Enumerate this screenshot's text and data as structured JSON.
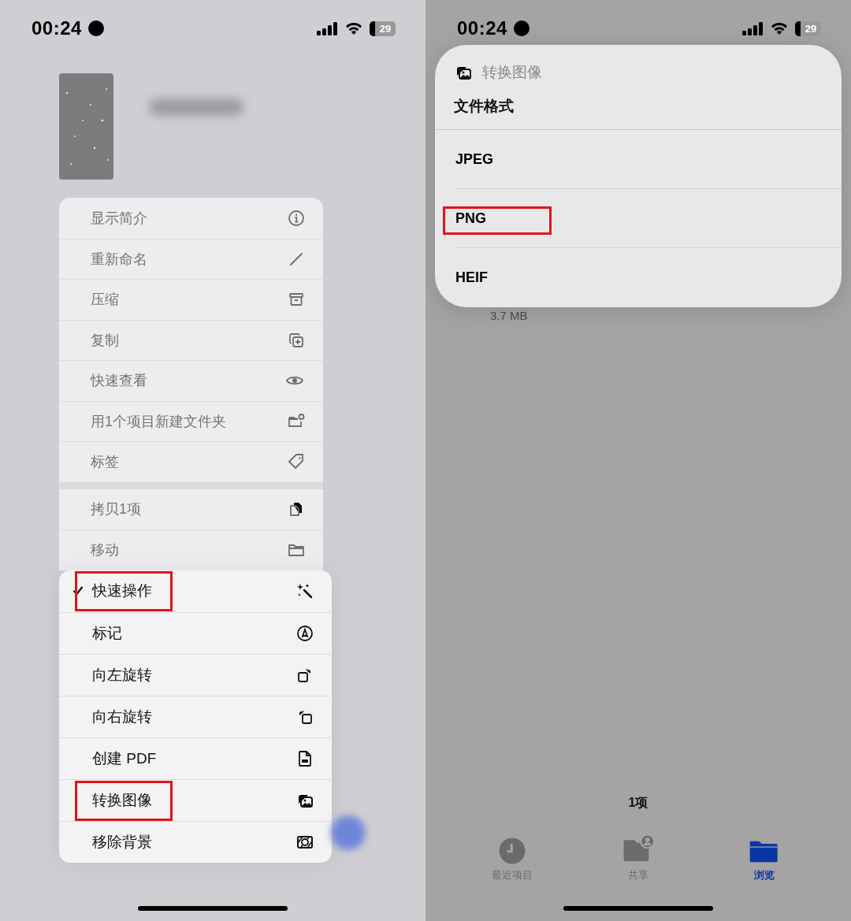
{
  "left_screen": {
    "status_bar": {
      "time": "00:24",
      "battery": "29"
    },
    "context_menu": {
      "groups": [
        [
          {
            "label": "显示简介"
          },
          {
            "label": "重新命名"
          },
          {
            "label": "压缩"
          },
          {
            "label": "复制"
          },
          {
            "label": "快速查看"
          },
          {
            "label": "用1个项目新建文件夹"
          },
          {
            "label": "标签"
          }
        ],
        [
          {
            "label": "拷贝1项"
          },
          {
            "label": "移动"
          }
        ]
      ]
    },
    "quick_actions_menu": {
      "items": [
        {
          "label": "快速操作",
          "checked": true,
          "highlighted": true
        },
        {
          "label": "标记",
          "checked": false,
          "highlighted": false
        },
        {
          "label": "向左旋转",
          "checked": false,
          "highlighted": false
        },
        {
          "label": "向右旋转",
          "checked": false,
          "highlighted": false
        },
        {
          "label": "创建 PDF",
          "checked": false,
          "highlighted": false
        },
        {
          "label": "转换图像",
          "checked": false,
          "highlighted": true
        },
        {
          "label": "移除背景",
          "checked": false,
          "highlighted": false
        }
      ]
    }
  },
  "right_screen": {
    "status_bar": {
      "time": "00:24",
      "battery": "29"
    },
    "format_menu": {
      "title": "转换图像",
      "subtitle": "文件格式",
      "options": [
        {
          "label": "JPEG",
          "highlighted": false
        },
        {
          "label": "PNG",
          "highlighted": true
        },
        {
          "label": "HEIF",
          "highlighted": false
        }
      ]
    },
    "file_size": "3.7 MB",
    "item_count": "1项",
    "tabs": [
      {
        "label": "最近项目",
        "selected": false
      },
      {
        "label": "共享",
        "selected": false
      },
      {
        "label": "浏览",
        "selected": true
      }
    ]
  }
}
